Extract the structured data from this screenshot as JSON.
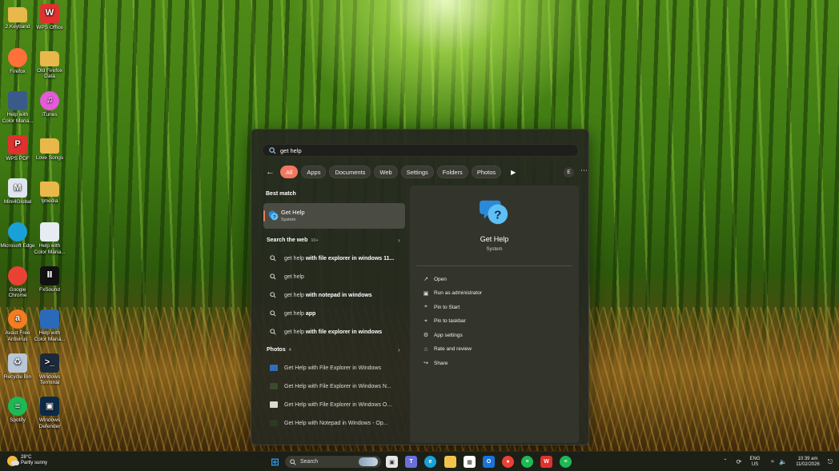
{
  "desktop": {
    "icons": [
      {
        "label": "2.Keyband",
        "icon": "folder-icon",
        "color": "#e8b84a"
      },
      {
        "label": "WPS Office",
        "icon": "wps-office-icon",
        "color": "#e0312e"
      },
      {
        "label": "Firefox",
        "icon": "firefox-icon",
        "color": "#ff7139"
      },
      {
        "label": "Old Firefox Data",
        "icon": "folder-icon",
        "color": "#e8b84a"
      },
      {
        "label": "Help with Color Mana...",
        "icon": "document-icon",
        "color": "#3a5a8a"
      },
      {
        "label": "iTunes",
        "icon": "itunes-icon",
        "color": "#e45ad8"
      },
      {
        "label": "WPS PDF",
        "icon": "wps-pdf-icon",
        "color": "#e0312e"
      },
      {
        "label": "Love Songs",
        "icon": "folder-icon",
        "color": "#e8b84a"
      },
      {
        "label": "Mini4Global",
        "icon": "app-icon",
        "color": "#dfe6ee"
      },
      {
        "label": "tjmedia",
        "icon": "folder-icon",
        "color": "#e8b84a"
      },
      {
        "label": "Microsoft Edge",
        "icon": "edge-icon",
        "color": "#1aa0d8"
      },
      {
        "label": "Help with Color Mana...",
        "icon": "document-icon",
        "color": "#e6ecf2"
      },
      {
        "label": "Google Chrome",
        "icon": "chrome-icon",
        "color": "#e94235"
      },
      {
        "label": "FxSound",
        "icon": "fxsound-icon",
        "color": "#111111"
      },
      {
        "label": "Avast Free Antivirus",
        "icon": "avast-icon",
        "color": "#f57c20"
      },
      {
        "label": "Help with Color Mana...",
        "icon": "document-icon",
        "color": "#2a6ab8"
      },
      {
        "label": "Recycle Bin",
        "icon": "recycle-bin-icon",
        "color": "#b9c7d6"
      },
      {
        "label": "Windows Terminal",
        "icon": "terminal-icon",
        "color": "#1c2a3a"
      },
      {
        "label": "Spotify",
        "icon": "spotify-icon",
        "color": "#1db954"
      },
      {
        "label": "Windows Defender",
        "icon": "defender-icon",
        "color": "#0b2a48"
      }
    ]
  },
  "search_panel": {
    "query": "get help",
    "filters": [
      "All",
      "Apps",
      "Documents",
      "Web",
      "Settings",
      "Folders",
      "Photos"
    ],
    "active_filter": "All",
    "account_initial": "E",
    "best_match": {
      "heading": "Best match",
      "name": "Get Help",
      "type": "System"
    },
    "web": {
      "heading": "Search the web",
      "count": "10+",
      "items": [
        {
          "base": "get help",
          "bold": " with file explorer in windows 11..."
        },
        {
          "base": "get help",
          "bold": ""
        },
        {
          "base": "get help",
          "bold": " with notepad in windows"
        },
        {
          "base": "get help",
          "bold": " app"
        },
        {
          "base": "get help",
          "bold": " with file explorer in windows"
        }
      ]
    },
    "photos": {
      "heading": "Photos",
      "count": "4",
      "items": [
        {
          "title": "Get Help with File Explorer in Windows",
          "thumb": "#2e6fb8"
        },
        {
          "title": "Get Help with File Explorer in Windows N...",
          "thumb": "#3a4a30"
        },
        {
          "title": "Get Help with File Explorer in Windows O...",
          "thumb": "#d8dccf"
        },
        {
          "title": "Get Help with Notepad in Windows - Op...",
          "thumb": "#2c3a22"
        }
      ]
    },
    "detail": {
      "app_name": "Get Help",
      "app_type": "System",
      "actions": [
        {
          "label": "Open",
          "icon": "open-icon"
        },
        {
          "label": "Run as administrator",
          "icon": "admin-icon"
        },
        {
          "label": "Pin to Start",
          "icon": "pin-icon"
        },
        {
          "label": "Pin to taskbar",
          "icon": "pin-icon"
        },
        {
          "label": "App settings",
          "icon": "gear-icon"
        },
        {
          "label": "Rate and review",
          "icon": "star-icon"
        },
        {
          "label": "Share",
          "icon": "share-icon"
        }
      ]
    },
    "accent_color": "#f07860"
  },
  "taskbar": {
    "weather_temp": "28°C",
    "weather_desc": "Partly sunny",
    "search_label": "Search",
    "apps": [
      {
        "name": "start-icon",
        "color": "#2aa0f0"
      },
      {
        "name": "task-view-icon",
        "color": "#e6e6e6"
      },
      {
        "name": "teams-icon",
        "color": "#6b6fd8"
      },
      {
        "name": "edge-icon",
        "color": "#1aa0d8"
      },
      {
        "name": "file-explorer-icon",
        "color": "#f2c44b"
      },
      {
        "name": "store-icon",
        "color": "#ffffff"
      },
      {
        "name": "outlook-icon",
        "color": "#1a73d8"
      },
      {
        "name": "chrome-icon",
        "color": "#e94235"
      },
      {
        "name": "spotify-icon",
        "color": "#1db954"
      },
      {
        "name": "wps-office-icon",
        "color": "#e0312e"
      },
      {
        "name": "spotify-icon",
        "color": "#1db954"
      }
    ],
    "tray": {
      "language": "ENG",
      "region": "US",
      "time": "10:39 am",
      "date": "11/02/2026"
    }
  }
}
